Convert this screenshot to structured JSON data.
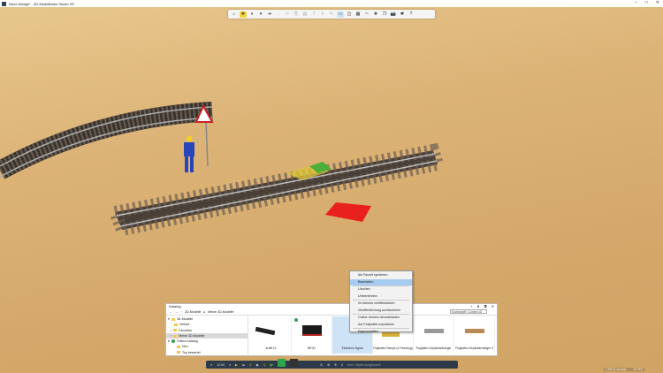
{
  "window": {
    "title": "Neue Anlage* - 3D-Modellbahn Studio V5",
    "controls": [
      "–",
      "□",
      "✕"
    ]
  },
  "toolbar": {
    "icons": [
      "home-icon",
      "move-icon",
      "pause-icon",
      "chevron-down-icon",
      "arrow-icon",
      "arrow-right-icon",
      "cut-icon",
      "copy-icon",
      "paste-icon",
      "chevron-down-icon",
      "text-icon",
      "grid-icon",
      "pencil-icon",
      "view2d-icon",
      "view3d-icon",
      "layers-icon",
      "mirror-icon",
      "add-icon",
      "clone-icon",
      "camera-icon",
      "puzzle-icon",
      "help-icon"
    ]
  },
  "context_menu": {
    "items": [
      {
        "label": "Als Favorit speichern"
      },
      {
        "label": "Bearbeiten",
        "highlight": true
      },
      {
        "sep": true
      },
      {
        "label": "Löschen"
      },
      {
        "label": "Umbenennen"
      },
      {
        "sep": true
      },
      {
        "label": "Im Internet veröffentlichen"
      },
      {
        "label": "Veröffentlichung zurückziehen"
      },
      {
        "sep": true
      },
      {
        "label": "Online-Version herunterladen"
      },
      {
        "label": "Auf Festplatte exportieren"
      },
      {
        "sep": true
      },
      {
        "label": "Eigenschaften"
      }
    ]
  },
  "catalog": {
    "title": "Katalog",
    "tools": [
      "+",
      "⬇",
      "⧉",
      "✕"
    ],
    "breadcrumb": [
      "3D-Modelle",
      "Meine 3D-Modelle"
    ],
    "search_placeholder": "Suchbegriff / Content-ID",
    "tree": [
      {
        "label": "3D-Modelle",
        "icon": "folder"
      },
      {
        "label": "Verlauf",
        "icon": "folder"
      },
      {
        "label": "Favoriten",
        "icon": "folder"
      },
      {
        "label": "Meine 3D-Modelle",
        "icon": "folder",
        "selected": true
      },
      {
        "label": "Online-Katalog",
        "icon": "globe"
      },
      {
        "label": "Neu",
        "icon": "folder"
      },
      {
        "label": "Top bewertet",
        "icon": "folder"
      }
    ],
    "tiles": [
      {
        "label": "schiff 10"
      },
      {
        "label": "BR 81"
      },
      {
        "label": "Einfaches Signal",
        "selected": true
      },
      {
        "label": "Flughafen Rampe (4 Fahrzeug)"
      },
      {
        "label": "Flughafen-Gepäckanhänger"
      },
      {
        "label": "Flughafen-Gepäckanhänger II"
      }
    ]
  },
  "bottombar": {
    "time": "12:00",
    "status": "Kein Objekt ausgewählt"
  },
  "statusbar": {
    "scale": "1:100 (1 m-max)",
    "fps": "33 FPS"
  }
}
